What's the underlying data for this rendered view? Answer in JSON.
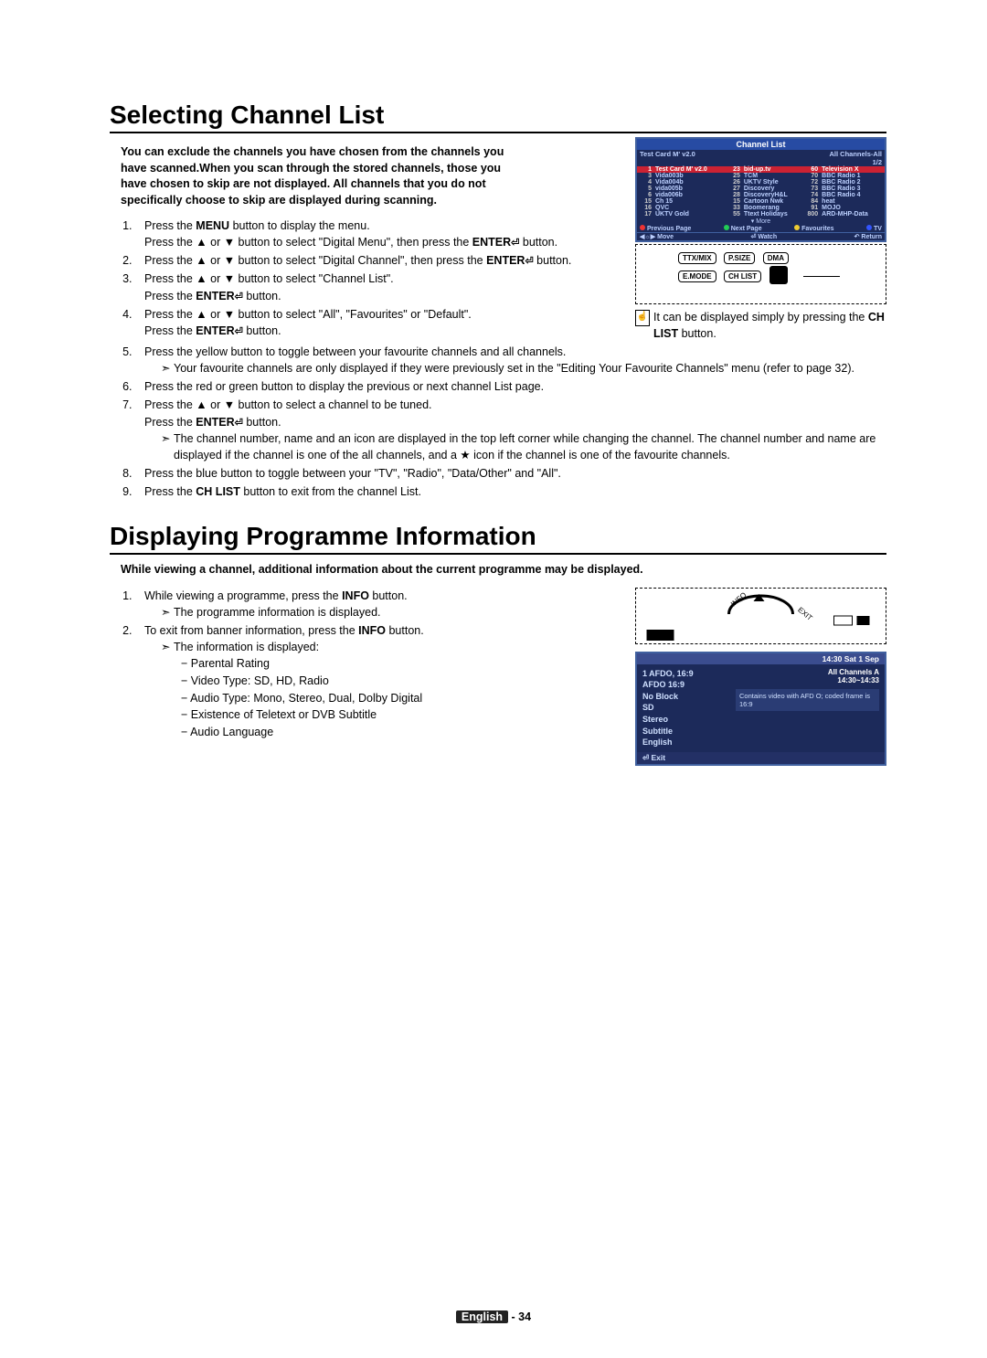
{
  "section1": {
    "title": "Selecting Channel List",
    "intro": "You can exclude the channels you have chosen from the channels you have scanned.When you scan through the stored channels, those you have chosen to skip are not displayed. All channels that you do not specifically choose to skip are displayed during scanning.",
    "steps": [
      {
        "a": "Press the ",
        "b": "MENU",
        "c": " button to display the menu.",
        "d": "Press the ▲ or ▼ button to select \"Digital Menu\", then press the ",
        "e": "ENTER",
        "f": " button."
      },
      {
        "a": "Press the ▲ or ▼ button to select \"Digital Channel\", then press the        ",
        "e": "ENTER",
        "f": " button."
      },
      {
        "a": "Press the ▲ or ▼ button to select \"Channel List\".",
        "d": "Press the ",
        "e": "ENTER",
        "f": " button."
      },
      {
        "a": "Press the ▲ or ▼ button to select \"All\", \"Favourites\" or \"Default\".",
        "d": "Press the ",
        "e": "ENTER",
        "f": " button."
      },
      {
        "a": "Press the yellow button to toggle between your favourite channels and all channels.",
        "sub": "Your favourite channels are only displayed if they were previously set in the \"Editing Your Favourite Channels\" menu (refer to page 32)."
      },
      {
        "a": "Press the red or green button to display the previous or next channel List page."
      },
      {
        "a": "Press the ▲ or ▼ button to select a channel to be tuned.",
        "d": "Press the ",
        "e": "ENTER",
        "f": " button.",
        "sub": "The channel number, name and an icon are displayed in the top left corner while changing the channel. The channel number and name are displayed if the channel is one of the all channels, and a ★ icon if the channel is one of the favourite channels."
      },
      {
        "a": "Press the blue button to toggle between your \"TV\", \"Radio\", \"Data/Other\" and \"All\"."
      },
      {
        "a": "Press the ",
        "b": "CH LIST",
        "c": " button to exit from the channel List."
      }
    ],
    "handtip": "It can be displayed simply by pressing the ",
    "handtip_b": "CH LIST",
    "handtip_c": " button."
  },
  "section2": {
    "title": "Displaying Programme Information",
    "intro": "While viewing a channel, additional information about the current programme may be displayed.",
    "steps": [
      {
        "a": "While viewing a programme, press the ",
        "b": "INFO",
        "c": " button.",
        "sub": "The programme information is displayed."
      },
      {
        "a": "To exit from banner information, press the ",
        "b": "INFO",
        "c": " button.",
        "sub": "The information is displayed:",
        "sublist": [
          "Parental Rating",
          "Video Type: SD, HD, Radio",
          "Audio Type: Mono, Stereo, Dual, Dolby Digital",
          "Existence of Teletext or DVB Subtitle",
          "Audio Language"
        ]
      }
    ]
  },
  "osd_channel": {
    "title": "Channel List",
    "topLeft": "Test Card M' v2.0",
    "topRight": "All Channels-All",
    "page": "1/2",
    "rows": [
      [
        "1",
        "Test Card M' v2.0",
        "23",
        "bid-up.tv",
        "60",
        "Television X"
      ],
      [
        "3",
        "Vida003b",
        "25",
        "TCM",
        "70",
        "BBC Radio 1"
      ],
      [
        "4",
        "Vida004b",
        "26",
        "UKTV Style",
        "72",
        "BBC Radio 2"
      ],
      [
        "5",
        "vida005b",
        "27",
        "Discovery",
        "73",
        "BBC Radio 3"
      ],
      [
        "6",
        "vida006b",
        "28",
        "DiscoveryH&L",
        "74",
        "BBC Radio 4"
      ],
      [
        "15",
        "Ch 15",
        "15",
        "Cartoon Nwk",
        "84",
        "heat"
      ],
      [
        "16",
        "QVC",
        "33",
        "Boomerang",
        "91",
        "MOJO"
      ],
      [
        "17",
        "UKTV Gold",
        "55",
        "Ttext Holidays",
        "800",
        "ARD-MHP-Data"
      ]
    ],
    "more": "▾ More",
    "legend": {
      "prev": "Previous Page",
      "next": "Next Page",
      "fav": "Favourites",
      "tv": "TV"
    },
    "bottom": {
      "move": "◀☼▶ Move",
      "watch": "⏎ Watch",
      "ret": "↶ Return"
    },
    "remoteButtons": [
      "TTX/MIX",
      "P.SIZE",
      "DMA",
      "E.MODE",
      "CH LIST"
    ]
  },
  "osd_info": {
    "time": "14:30 Sat 1 Sep",
    "leftcol": [
      "1 AFDO, 16:9",
      "AFDO 16:9",
      "No Block",
      "SD",
      "Stereo",
      "Subtitle",
      "English"
    ],
    "rightTop": "All Channels   A",
    "rightTime": "14:30~14:33",
    "desc": "Contains video with AFD O; coded frame is 16:9",
    "exit": "⏎ Exit"
  },
  "footer": {
    "lang": "English",
    "page": " - 34"
  }
}
